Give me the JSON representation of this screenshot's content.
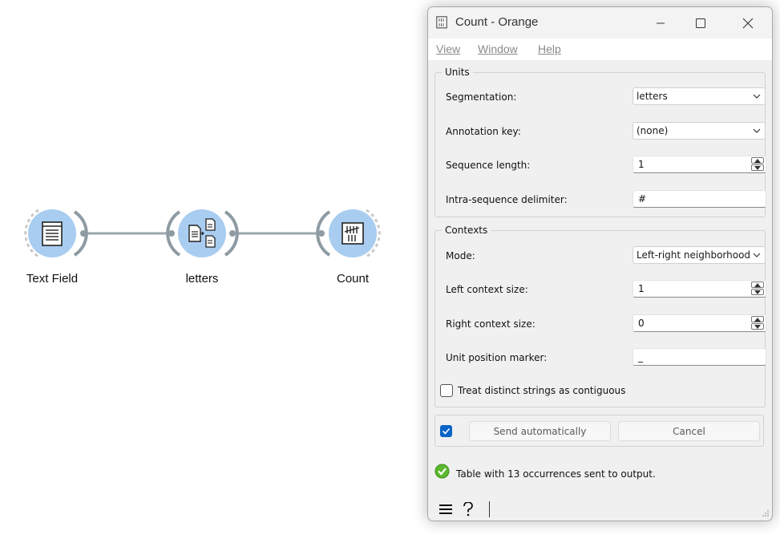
{
  "canvas": {
    "nodes": [
      {
        "label": "Text Field",
        "icon": "text-field-icon"
      },
      {
        "label": "letters",
        "icon": "segment-icon"
      },
      {
        "label": "Count",
        "icon": "count-icon"
      }
    ],
    "node_color": "#a9cdf0",
    "link_color": "#9aa6ad"
  },
  "window": {
    "title": "Count - Orange",
    "menu": {
      "view": "View",
      "window": "Window",
      "help": "Help"
    },
    "units": {
      "legend": "Units",
      "segmentation_label": "Segmentation:",
      "segmentation_value": "letters",
      "annotation_label": "Annotation key:",
      "annotation_value": "(none)",
      "seq_length_label": "Sequence length:",
      "seq_length_value": "1",
      "delimiter_label": "Intra-sequence delimiter:",
      "delimiter_value": "#"
    },
    "contexts": {
      "legend": "Contexts",
      "mode_label": "Mode:",
      "mode_value": "Left-right neighborhood",
      "left_label": "Left context size:",
      "left_value": "1",
      "right_label": "Right context size:",
      "right_value": "0",
      "marker_label": "Unit position marker:",
      "marker_value": "_",
      "treat_label": "Treat distinct strings as contiguous"
    },
    "send": {
      "auto_checked": true,
      "send_label": "Send automatically",
      "cancel_label": "Cancel"
    },
    "status": "Table with 13 occurrences sent to output.",
    "accent": "#0a64c8",
    "ok_color": "#5cb82e"
  }
}
